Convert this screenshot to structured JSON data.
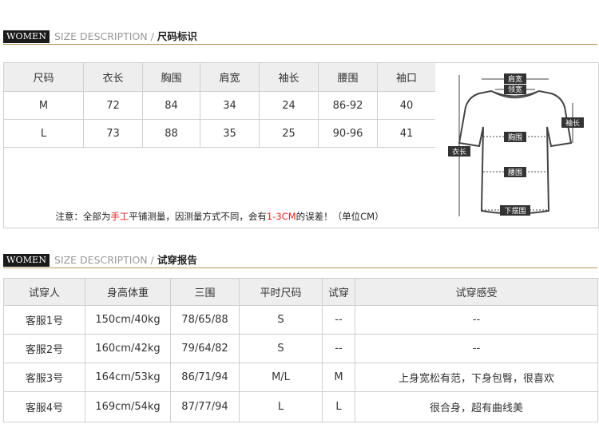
{
  "section1": {
    "tag": "WOMEN",
    "desc_en": "SIZE DESCRIPTION /",
    "desc_zh": "尺码标识"
  },
  "size_table": {
    "headers": [
      "尺码",
      "衣长",
      "胸围",
      "肩宽",
      "袖长",
      "腰围",
      "袖口"
    ],
    "rows": [
      [
        "M",
        "72",
        "84",
        "34",
        "24",
        "86-92",
        "40"
      ],
      [
        "L",
        "73",
        "88",
        "35",
        "25",
        "90-96",
        "41"
      ]
    ],
    "note": {
      "part1": "注意：全部为",
      "part2": "手工",
      "part3": "平铺测量，因测量方式不同，会有",
      "part4": "1-3CM",
      "part5": "的误差！（单位CM）"
    }
  },
  "diagram": {
    "labels": {
      "shoulder": "肩宽",
      "neck": "领宽",
      "sleeve": "袖长",
      "length": "衣长",
      "chest": "胸围",
      "waist": "腰围",
      "hem": "下摆围"
    }
  },
  "section2": {
    "tag": "WOMEN",
    "desc_en": "SIZE DESCRIPTION /",
    "desc_zh": "试穿报告"
  },
  "fit_table": {
    "headers": [
      "试穿人",
      "身高体重",
      "三围",
      "平时尺码",
      "试穿",
      "试穿感受"
    ],
    "rows": [
      [
        "客服1号",
        "150cm/40kg",
        "78/65/88",
        "S",
        "--",
        "--"
      ],
      [
        "客服2号",
        "160cm/42kg",
        "79/64/82",
        "S",
        "--",
        "--"
      ],
      [
        "客服3号",
        "164cm/53kg",
        "86/71/94",
        "M/L",
        "M",
        "上身宽松有范，下身包臀，很喜欢"
      ],
      [
        "客服4号",
        "169cm/54kg",
        "87/77/94",
        "L",
        "L",
        "很合身，超有曲线美"
      ]
    ]
  },
  "colors": {
    "header_bg": "#eeeeee",
    "rule": "#b79650",
    "accent_red": "#dd2222",
    "border": "#cfcfcf"
  }
}
